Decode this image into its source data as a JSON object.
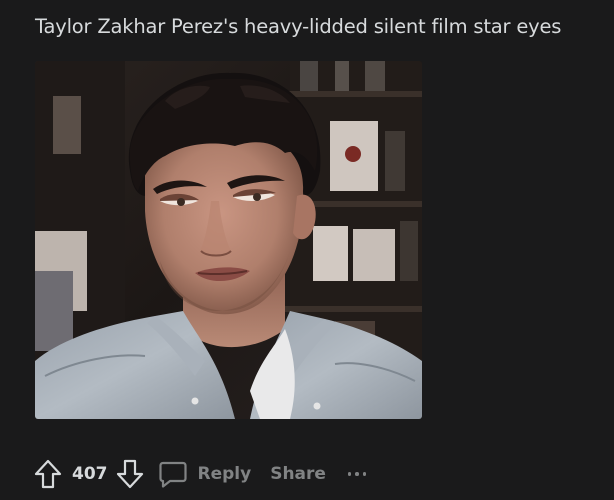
{
  "post": {
    "title": "Taylor Zakhar Perez's heavy-lidded silent film star eyes",
    "media": {
      "kind": "photo",
      "description": "man with dark curly hair in a denim shirt"
    }
  },
  "actions": {
    "vote_count": "407",
    "reply_label": "Reply",
    "share_label": "Share"
  },
  "icons": {
    "upvote": "upvote-arrow-icon",
    "downvote": "downvote-arrow-icon",
    "reply": "comment-bubble-icon",
    "more": "more-options-icon"
  },
  "colors": {
    "background": "#1a1a1b",
    "text": "#d7dadc",
    "muted": "#818384"
  }
}
